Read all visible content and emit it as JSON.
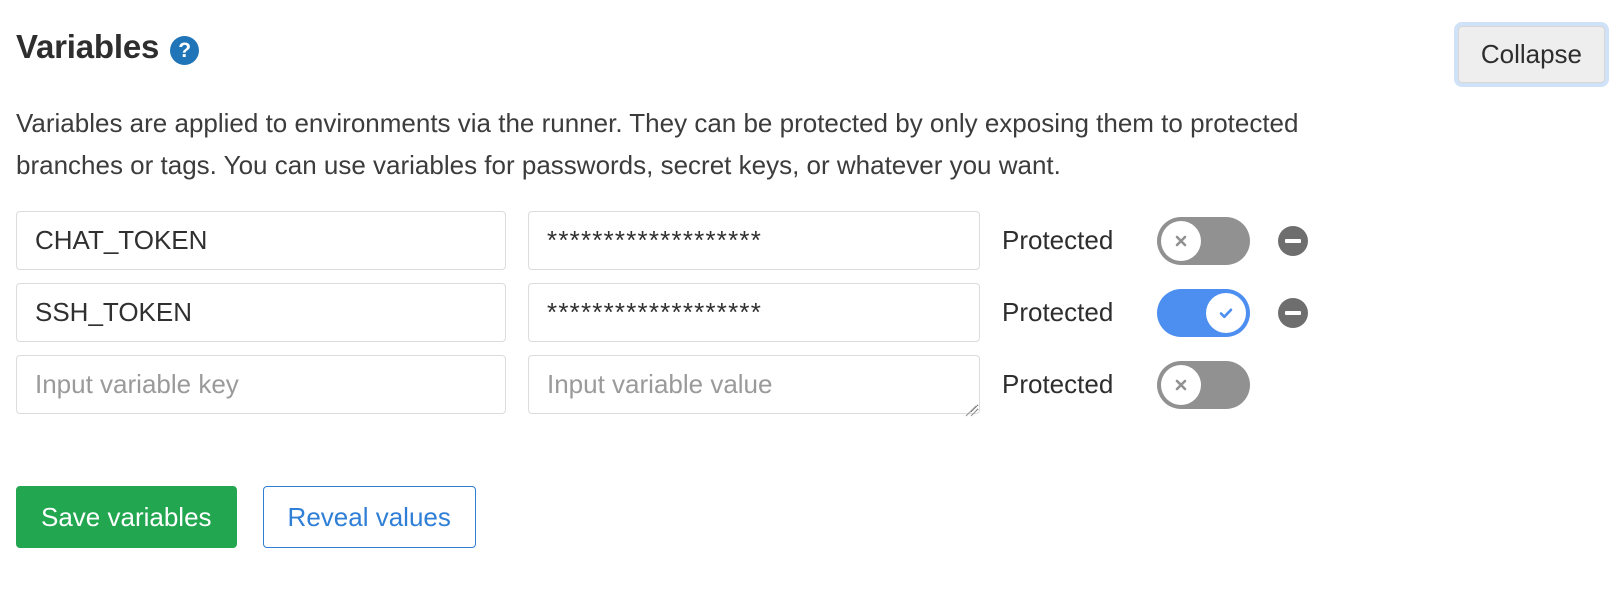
{
  "header": {
    "title": "Variables",
    "help_icon": "question-circle-icon",
    "help_icon_color": "#1f75b7",
    "collapse_label": "Collapse"
  },
  "description": "Variables are applied to environments via the runner. They can be protected by only exposing them to protected branches or tags. You can use variables for passwords, secret keys, or whatever you want.",
  "labels": {
    "protected": "Protected",
    "remove_icon": "minus-circle-icon",
    "toggle_on_icon": "check-icon",
    "toggle_off_icon": "cross-icon"
  },
  "placeholders": {
    "key": "Input variable key",
    "value": "Input variable value"
  },
  "rows": [
    {
      "key": "CHAT_TOKEN",
      "value": "*******************",
      "protected_label": "Protected",
      "protected": false,
      "removable": true
    },
    {
      "key": "SSH_TOKEN",
      "value": "*******************",
      "protected_label": "Protected",
      "protected": true,
      "removable": true
    },
    {
      "key": "",
      "value": "",
      "protected_label": "Protected",
      "protected": false,
      "removable": false
    }
  ],
  "actions": {
    "save_label": "Save variables",
    "reveal_label": "Reveal values",
    "save_color": "#22a64f",
    "reveal_color": "#2f7fd6"
  },
  "colors": {
    "toggle_on": "#4c8ff0",
    "toggle_off": "#919191",
    "focus_ring": "#cfe2f7"
  }
}
